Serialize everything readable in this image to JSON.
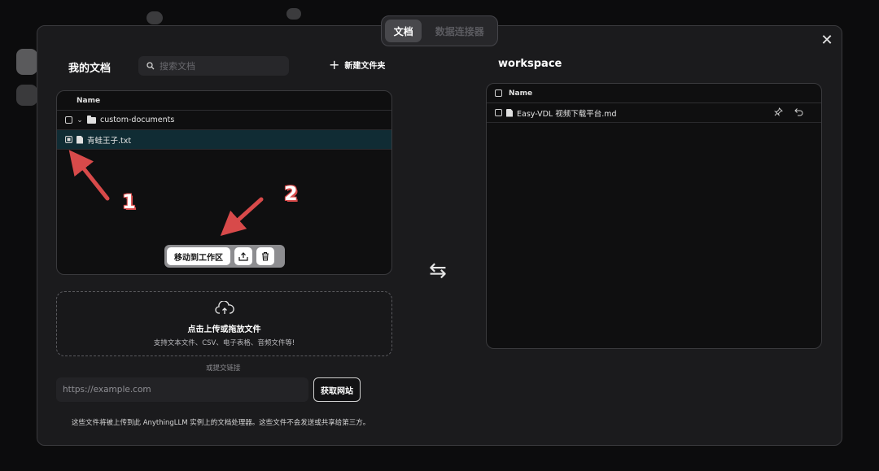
{
  "top_tabs": [
    {
      "label": "文档",
      "active": true
    },
    {
      "label": "数据连接器",
      "active": false
    }
  ],
  "my_docs": {
    "title": "我的文档",
    "search_placeholder": "搜索文档",
    "new_folder_label": "新建文件夹",
    "column_header": "Name",
    "rows": [
      {
        "name": "custom-documents",
        "type": "folder",
        "expanded": true,
        "checked": false
      },
      {
        "name": "青蛙王子.txt",
        "type": "file",
        "checked": true,
        "selected": true
      }
    ],
    "action_bar": {
      "move_label": "移动到工作区",
      "upload_icon": "upload-tray-icon",
      "delete_icon": "trash-icon"
    }
  },
  "workspace": {
    "title": "workspace",
    "column_header": "Name",
    "rows": [
      {
        "name": "Easy-VDL 视频下载平台.md",
        "type": "file",
        "checked": false
      }
    ]
  },
  "upload": {
    "title": "点击上传或拖放文件",
    "subtitle": "支持文本文件、CSV、电子表格、音频文件等!",
    "or_link": "或提交链接",
    "url_placeholder": "https://example.com",
    "fetch_label": "获取网站"
  },
  "footer_note": "这些文件将被上传到此 AnythingLLM 实例上的文档处理器。这些文件不会发送或共享给第三方。",
  "annotations": {
    "label_1": "1",
    "label_2": "2"
  },
  "colors": {
    "selected_row": "#102c34",
    "arrow": "#d84a4a",
    "modal_bg": "#1b1b1d"
  }
}
